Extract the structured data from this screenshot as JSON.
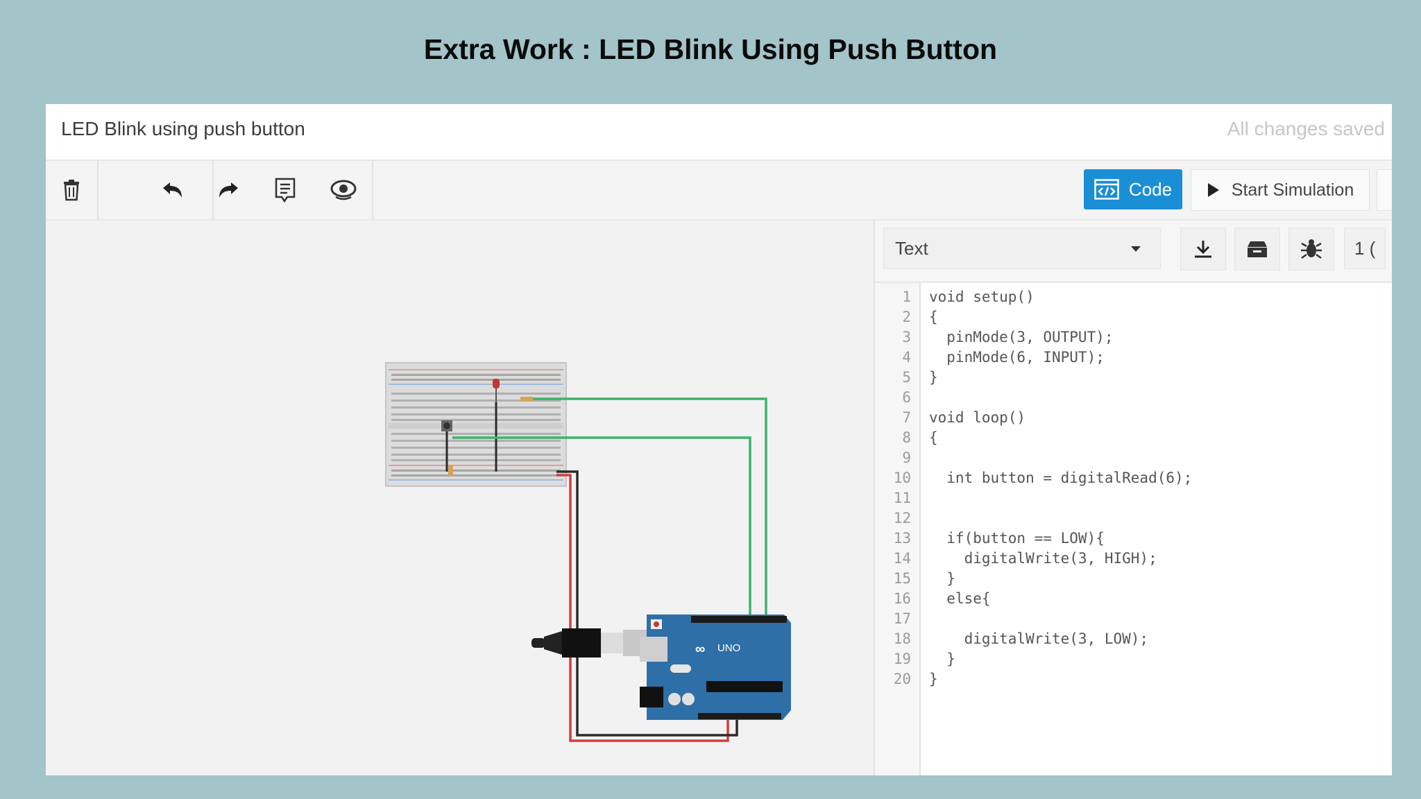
{
  "slide": {
    "title": "Extra Work : LED Blink Using Push Button"
  },
  "window": {
    "project_name": "LED Blink using push button",
    "save_status": "All changes saved"
  },
  "toolbar": {
    "icons": [
      "trash-icon",
      "undo-icon",
      "redo-icon",
      "notes-icon",
      "eye-icon"
    ],
    "code_label": "Code",
    "simulation_label": "Start Simulation",
    "accent_color": "#1b8fd6"
  },
  "code_editor": {
    "mode": "Text",
    "icons": [
      "download-icon",
      "library-icon",
      "debug-icon"
    ],
    "extra_label": "1 (",
    "lines": [
      {
        "n": "1",
        "text": "void setup()"
      },
      {
        "n": "2",
        "text": "{"
      },
      {
        "n": "3",
        "text": "  pinMode(3, OUTPUT);"
      },
      {
        "n": "4",
        "text": "  pinMode(6, INPUT);"
      },
      {
        "n": "5",
        "text": "}"
      },
      {
        "n": "6",
        "text": ""
      },
      {
        "n": "7",
        "text": "void loop()"
      },
      {
        "n": "8",
        "text": "{"
      },
      {
        "n": "9",
        "text": ""
      },
      {
        "n": "10",
        "text": "  int button = digitalRead(6);"
      },
      {
        "n": "11",
        "text": ""
      },
      {
        "n": "12",
        "text": ""
      },
      {
        "n": "13",
        "text": "  if(button == LOW){"
      },
      {
        "n": "14",
        "text": "    digitalWrite(3, HIGH);"
      },
      {
        "n": "15",
        "text": "  }"
      },
      {
        "n": "16",
        "text": "  else{"
      },
      {
        "n": "17",
        "text": ""
      },
      {
        "n": "18",
        "text": "    digitalWrite(3, LOW);"
      },
      {
        "n": "19",
        "text": "  }"
      },
      {
        "n": "20",
        "text": "}"
      }
    ]
  },
  "circuit": {
    "board_label": "UNO",
    "wire_colors": {
      "green": "#3db36b",
      "red": "#d63c3c",
      "black": "#2b2b2b"
    }
  }
}
